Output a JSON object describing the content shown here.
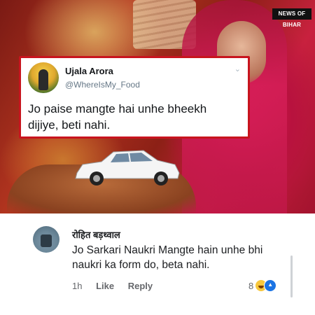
{
  "banner": {
    "watermark": "NEWS OF BIHAR"
  },
  "tweet": {
    "name": "Ujala Arora",
    "handle": "@WhereIsMy_Food",
    "text": "Jo paise mangte hai unhe bheekh dijiye, beti nahi."
  },
  "comment": {
    "author": "रोहित बड़थ्वाल",
    "text": "Jo Sarkari Naukri Mangte hain unhe bhi naukri ka form do, beta nahi.",
    "time": "1h",
    "like_label": "Like",
    "reply_label": "Reply",
    "reaction_count": "8",
    "reaction_icons": [
      "haha-icon",
      "like-icon"
    ]
  },
  "colors": {
    "tweet_border": "#c8141e",
    "link_blue": "#1b74e4"
  }
}
